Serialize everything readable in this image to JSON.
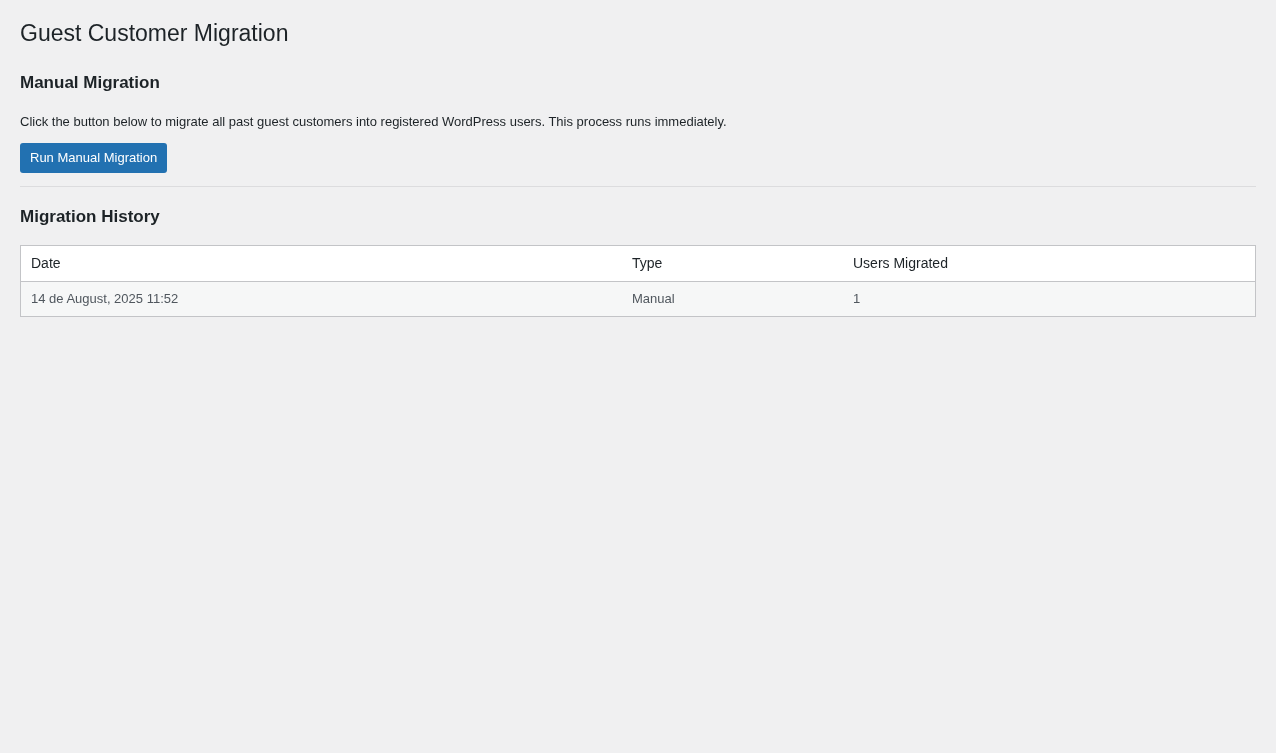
{
  "title": "Guest Customer Migration",
  "manual": {
    "heading": "Manual Migration",
    "description": "Click the button below to migrate all past guest customers into registered WordPress users. This process runs immediately.",
    "button": "Run Manual Migration"
  },
  "history": {
    "heading": "Migration History",
    "columns": [
      "Date",
      "Type",
      "Users Migrated"
    ],
    "rows": [
      [
        "14 de August, 2025 11:52",
        "Manual",
        "1"
      ]
    ]
  }
}
